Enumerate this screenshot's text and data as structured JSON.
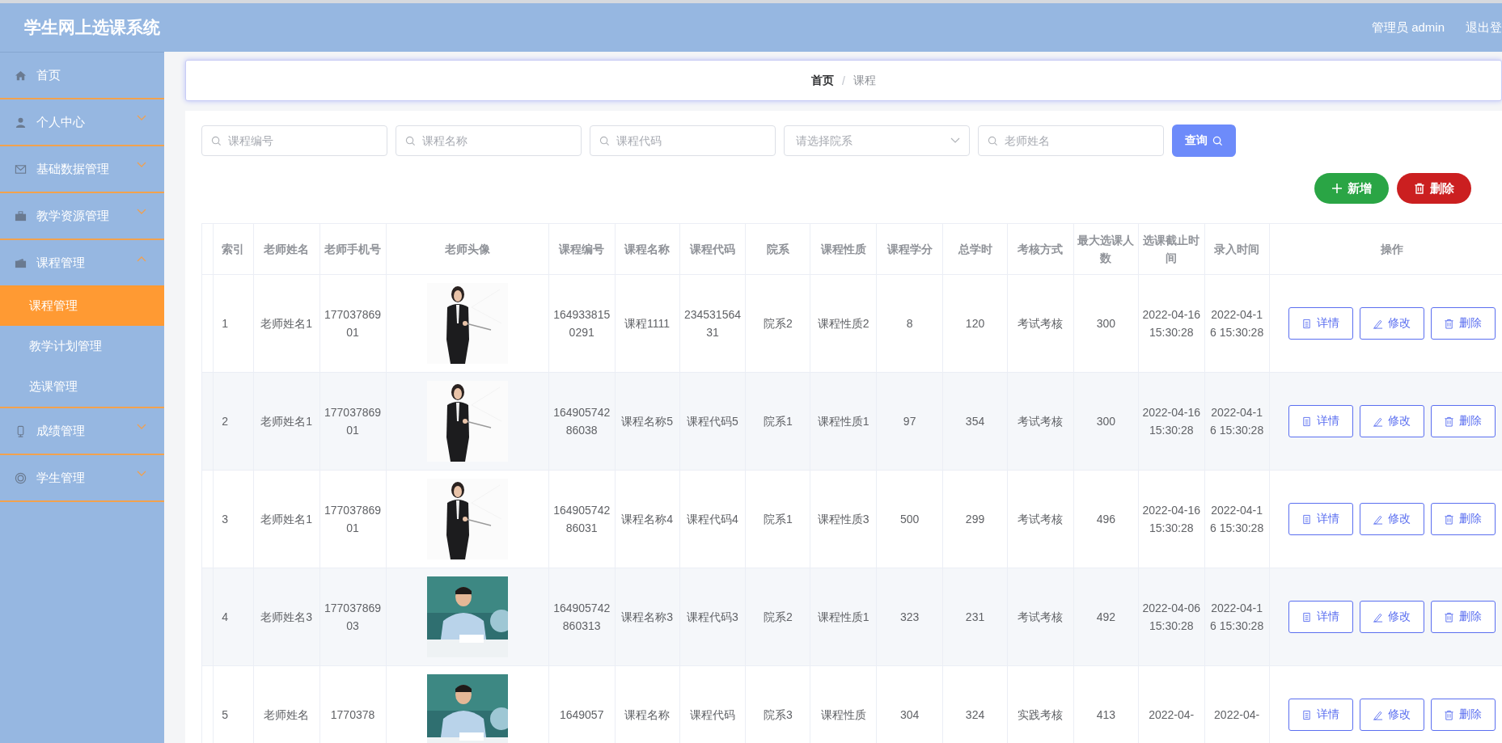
{
  "header": {
    "title": "学生网上选课系统",
    "user": "管理员 admin",
    "logout": "退出登"
  },
  "sidebar": {
    "items": [
      {
        "label": "首页"
      },
      {
        "label": "个人中心",
        "expanded": false
      },
      {
        "label": "基础数据管理",
        "expanded": false
      },
      {
        "label": "教学资源管理",
        "expanded": false
      },
      {
        "label": "课程管理",
        "expanded": true,
        "children": [
          {
            "label": "课程管理",
            "selected": true
          },
          {
            "label": "教学计划管理",
            "selected": false
          },
          {
            "label": "选课管理",
            "selected": false
          }
        ]
      },
      {
        "label": "成绩管理",
        "expanded": false
      },
      {
        "label": "学生管理",
        "expanded": false
      }
    ]
  },
  "breadcrumb": {
    "items": [
      "首页",
      "课程"
    ],
    "separator": "/"
  },
  "filters": [
    {
      "kind": "search",
      "placeholder": "课程编号"
    },
    {
      "kind": "search",
      "placeholder": "课程名称"
    },
    {
      "kind": "search",
      "placeholder": "课程代码"
    },
    {
      "kind": "select",
      "placeholder": "请选择院系"
    },
    {
      "kind": "search",
      "placeholder": "老师姓名"
    }
  ],
  "query_button": "查询",
  "actions": [
    {
      "kind": "add",
      "label": "新增"
    },
    {
      "kind": "delete",
      "label": "删除"
    }
  ],
  "table": {
    "columns": [
      "索引",
      "老师姓名",
      "老师手机号",
      "老师头像",
      "课程编号",
      "课程名称",
      "课程代码",
      "院系",
      "课程性质",
      "课程学分",
      "总学时",
      "考核方式",
      "最大选课人数",
      "选课截止时间",
      "录入时间",
      "操作"
    ],
    "rows": [
      {
        "cells": [
          "1",
          "老师姓名1",
          "17703786901",
          {
            "kind": "picture"
          },
          "1649338150291",
          "课程1111",
          "23453156431",
          "院系2",
          "课程性质2",
          "8",
          "120",
          "考试考核",
          "300",
          "2022-04-16 15:30:28",
          "2022-04-16 15:30:28"
        ],
        "buttons": [
          "详情",
          "修改",
          "删除"
        ]
      },
      {
        "cells": [
          "2",
          "老师姓名1",
          "17703786901",
          {
            "kind": "picture"
          },
          "16490574286038",
          "课程名称5",
          "课程代码5",
          "院系1",
          "课程性质1",
          "97",
          "354",
          "考试考核",
          "300",
          "2022-04-16 15:30:28",
          "2022-04-16 15:30:28"
        ],
        "buttons": [
          "详情",
          "修改",
          "删除"
        ]
      },
      {
        "cells": [
          "3",
          "老师姓名1",
          "17703786901",
          {
            "kind": "picture"
          },
          "16490574286031",
          "课程名称4",
          "课程代码4",
          "院系1",
          "课程性质3",
          "500",
          "299",
          "考试考核",
          "496",
          "2022-04-16 15:30:28",
          "2022-04-16 15:30:28"
        ],
        "buttons": [
          "详情",
          "修改",
          "删除"
        ]
      },
      {
        "cells": [
          "4",
          "老师姓名3",
          "17703786903",
          {
            "kind": "picture"
          },
          "164905742860313",
          "课程名称3",
          "课程代码3",
          "院系2",
          "课程性质1",
          "323",
          "231",
          "考试考核",
          "492",
          "2022-04-06 15:30:28",
          "2022-04-16 15:30:28"
        ],
        "buttons": [
          "详情",
          "修改",
          "删除"
        ]
      },
      {
        "cells": [
          "5",
          "老师姓名",
          "1770378",
          {
            "kind": "picture"
          },
          "1649057",
          "课程名称",
          "课程代码",
          "院系3",
          "课程性质",
          "304",
          "324",
          "实践考核",
          "413",
          "2022-04-",
          "2022-04-"
        ],
        "buttons": [
          "详情",
          "修改",
          "删除"
        ]
      }
    ]
  }
}
